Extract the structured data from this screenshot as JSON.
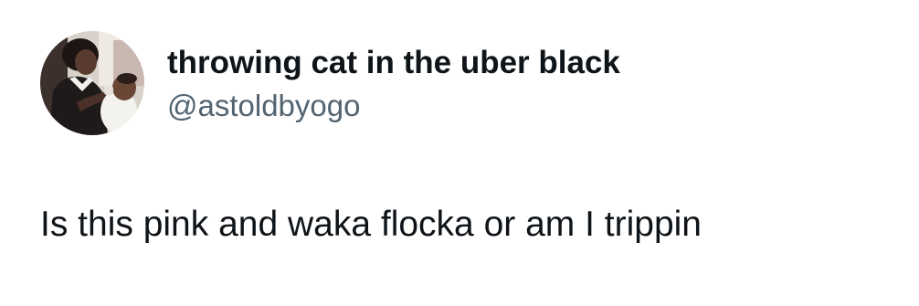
{
  "tweet": {
    "author": {
      "display_name": "throwing cat in the uber black",
      "handle": "@astoldbyogo",
      "avatar_icon": "profile-photo"
    },
    "text": "Is this pink and waka flocka or am I trippin"
  },
  "colors": {
    "background": "#ffffff",
    "primary_text": "#0f1419",
    "secondary_text": "#536471"
  }
}
